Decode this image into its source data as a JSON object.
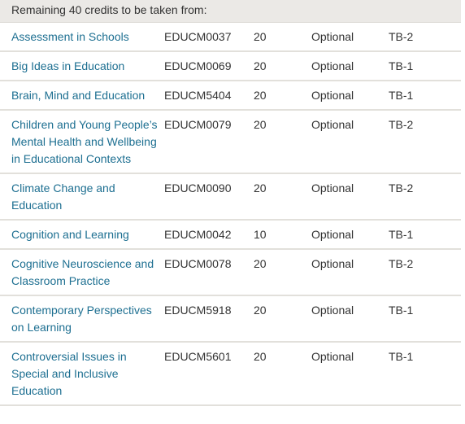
{
  "header": {
    "text": "Remaining 40 credits to be taken from:"
  },
  "units": [
    {
      "title": "Assessment in Schools",
      "code": "EDUCM0037",
      "credits": "20",
      "status": "Optional",
      "teaching_block": "TB-2"
    },
    {
      "title": "Big Ideas in Education",
      "code": "EDUCM0069",
      "credits": "20",
      "status": "Optional",
      "teaching_block": "TB-1"
    },
    {
      "title": "Brain, Mind and Education",
      "code": "EDUCM5404",
      "credits": "20",
      "status": "Optional",
      "teaching_block": "TB-1"
    },
    {
      "title": "Children and Young People’s Mental Health and Wellbeing in Educational Contexts",
      "code": "EDUCM0079",
      "credits": "20",
      "status": "Optional",
      "teaching_block": "TB-2"
    },
    {
      "title": "Climate Change and Education",
      "code": "EDUCM0090",
      "credits": "20",
      "status": "Optional",
      "teaching_block": "TB-2"
    },
    {
      "title": "Cognition and Learning",
      "code": "EDUCM0042",
      "credits": "10",
      "status": "Optional",
      "teaching_block": "TB-1"
    },
    {
      "title": "Cognitive Neuroscience and Classroom Practice",
      "code": "EDUCM0078",
      "credits": "20",
      "status": "Optional",
      "teaching_block": "TB-2"
    },
    {
      "title": "Contemporary Perspectives on Learning",
      "code": "EDUCM5918",
      "credits": "20",
      "status": "Optional",
      "teaching_block": "TB-1"
    },
    {
      "title": "Controversial Issues in Special and Inclusive Education",
      "code": "EDUCM5601",
      "credits": "20",
      "status": "Optional",
      "teaching_block": "TB-1"
    }
  ],
  "colors": {
    "link": "#1d6f91",
    "header_bg": "#ebe9e6",
    "text": "#333333",
    "divider": "#e2e0db"
  }
}
